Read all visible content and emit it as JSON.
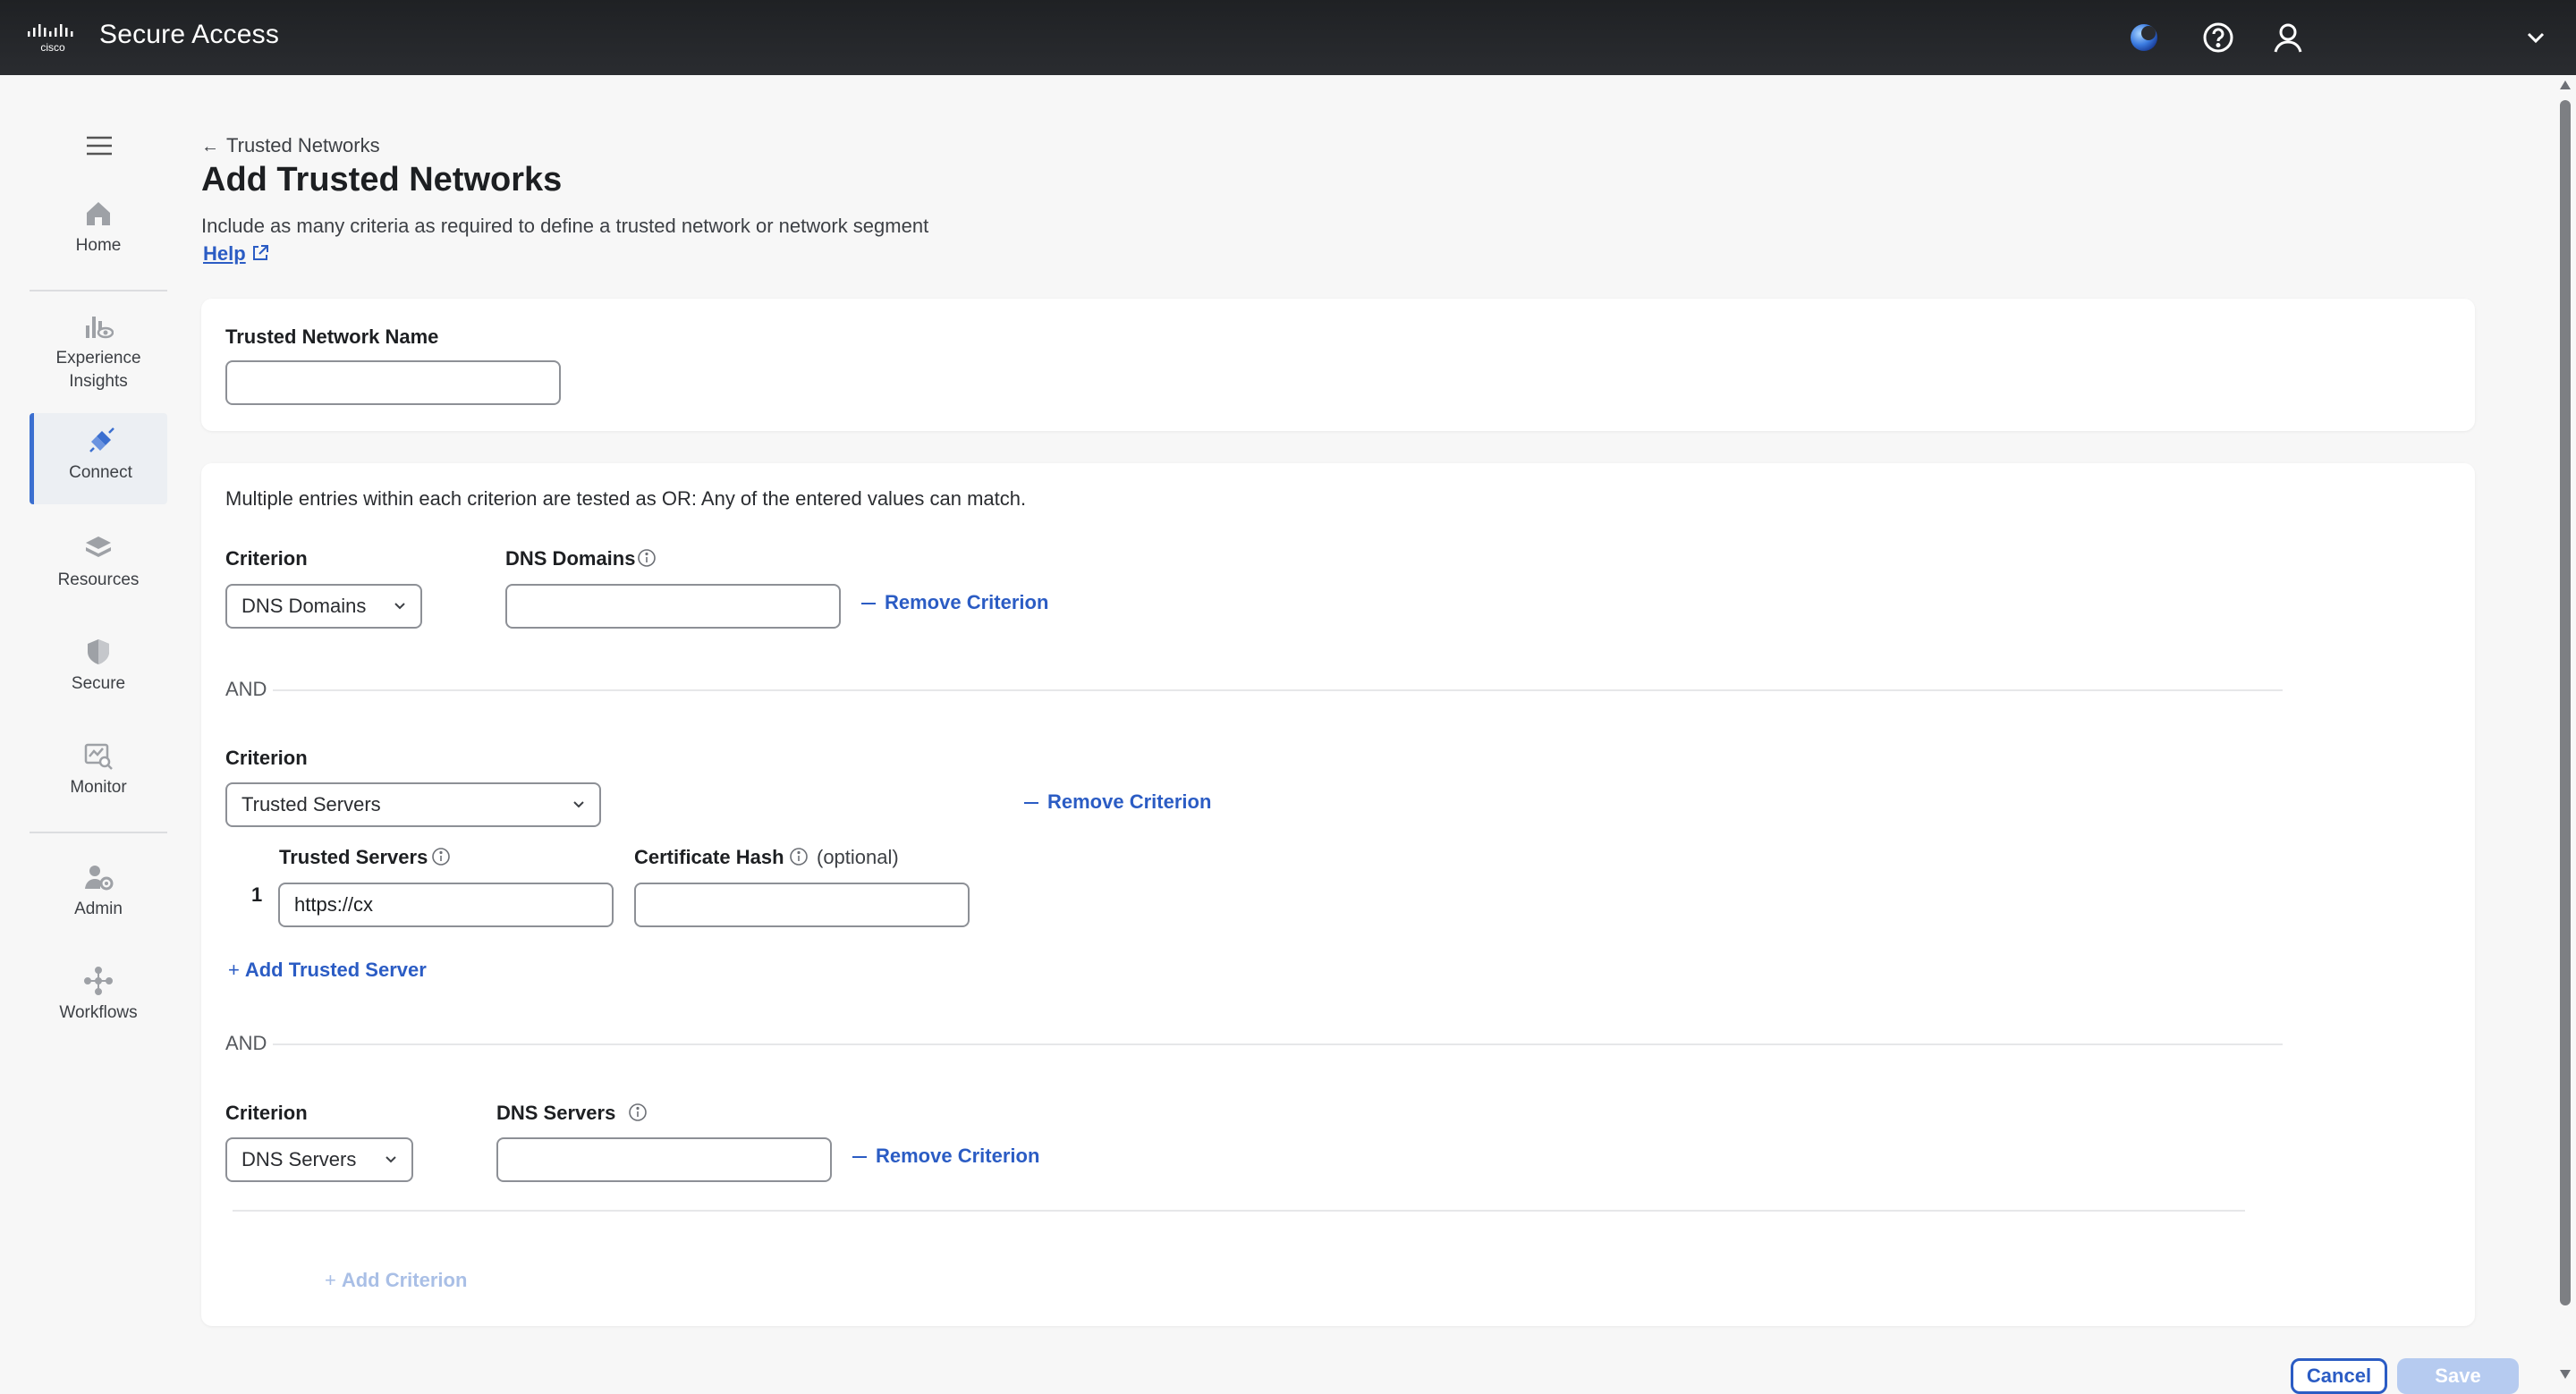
{
  "app": {
    "title": "Secure Access",
    "brand": "cisco",
    "colors": {
      "accent": "#2b5cc4",
      "topbar": "#1f2124",
      "active_nav": "#3b6fd0"
    }
  },
  "header_icons": [
    "status-orb-icon",
    "help-circle-icon",
    "user-icon",
    "chevron-down-icon"
  ],
  "sidebar": {
    "items": [
      {
        "label": "Home",
        "icon": "home-icon"
      },
      {
        "label": "Experience Insights",
        "label_line1": "Experience",
        "label_line2": "Insights",
        "icon": "insights-icon"
      },
      {
        "label": "Connect",
        "icon": "connect-icon",
        "active": true
      },
      {
        "label": "Resources",
        "icon": "resources-icon"
      },
      {
        "label": "Secure",
        "icon": "shield-icon"
      },
      {
        "label": "Monitor",
        "icon": "monitor-icon"
      },
      {
        "label": "Admin",
        "icon": "admin-icon"
      },
      {
        "label": "Workflows",
        "icon": "workflows-icon"
      }
    ]
  },
  "page": {
    "breadcrumb": "Trusted Networks",
    "title": "Add Trusted Networks",
    "subtitle": "Include as many criteria as required to define a trusted network or network segment",
    "help_label": "Help"
  },
  "name_card": {
    "label": "Trusted Network Name",
    "value": ""
  },
  "criteria_card": {
    "intro": "Multiple entries within each criterion are tested as OR: Any of the entered values can match.",
    "criterion_label": "Criterion",
    "and_label": "AND",
    "remove_label": "Remove Criterion",
    "criteria": [
      {
        "selected": "DNS Domains",
        "field_label": "DNS Domains",
        "value": ""
      },
      {
        "selected": "Trusted Servers",
        "servers_label": "Trusted Servers",
        "hash_label": "Certificate Hash",
        "hash_optional": "(optional)",
        "rows": [
          {
            "index": "1",
            "server": "https://cx",
            "hash": ""
          }
        ],
        "add_server_label": "Add Trusted Server"
      },
      {
        "selected": "DNS Servers",
        "field_label": "DNS Servers",
        "value": ""
      }
    ],
    "add_criterion_label": "Add Criterion"
  },
  "footer": {
    "cancel_label": "Cancel",
    "save_label": "Save"
  }
}
